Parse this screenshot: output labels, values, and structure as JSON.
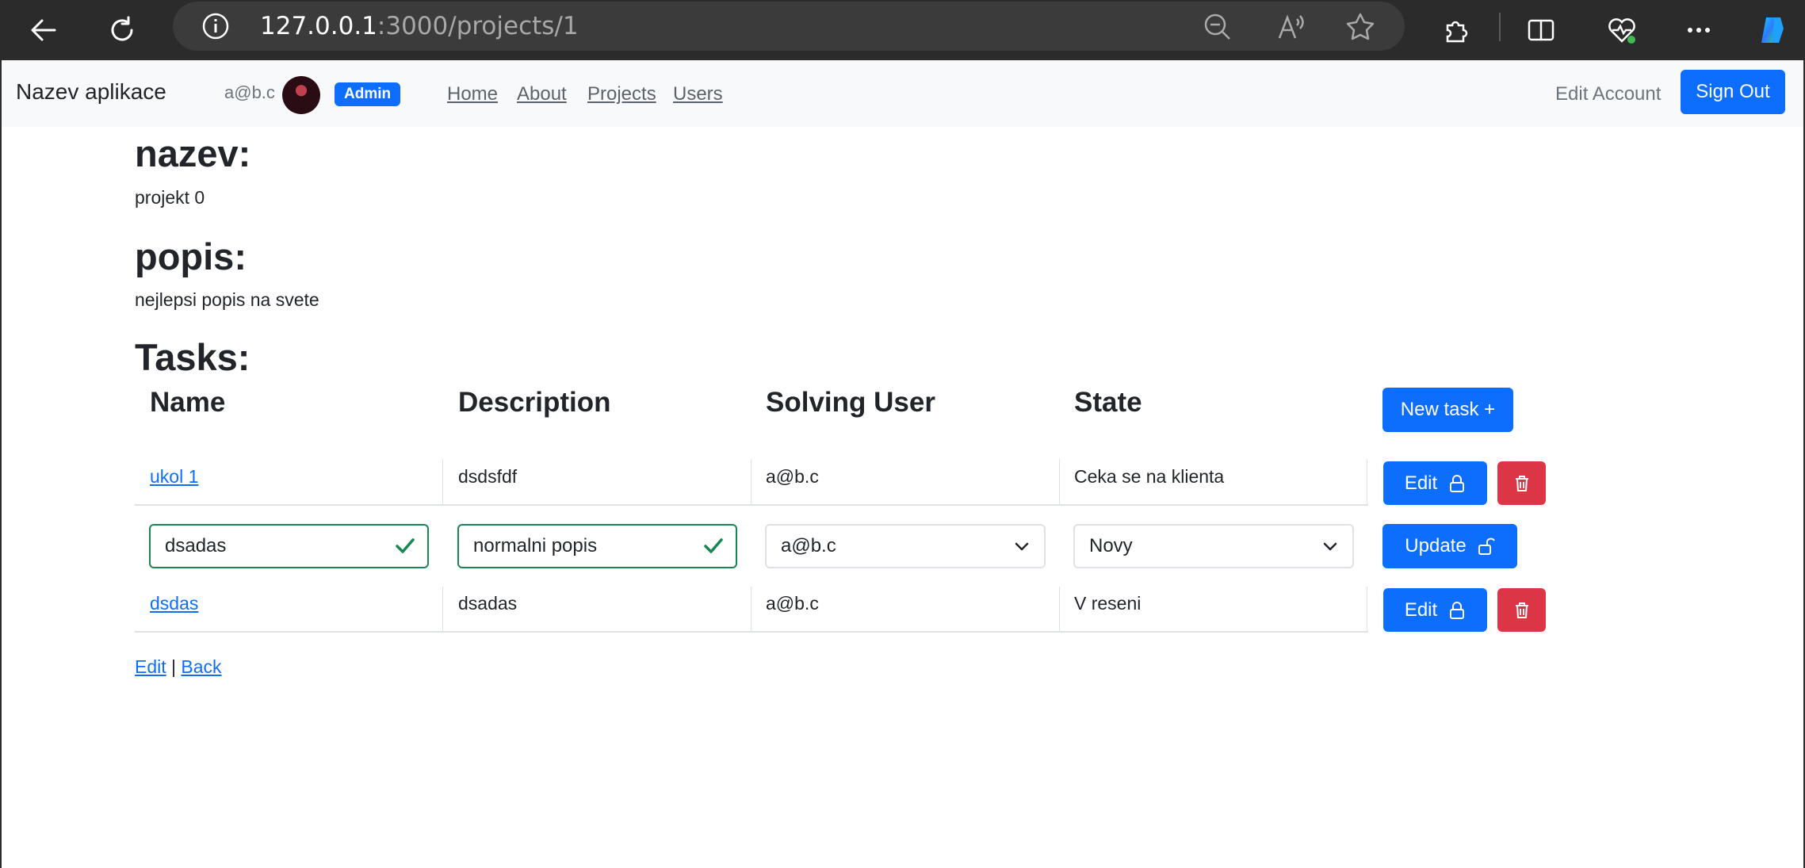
{
  "browser": {
    "url_host": "127.0.0.1",
    "url_path": ":3000/projects/1",
    "icons": [
      "back-arrow-icon",
      "refresh-icon",
      "info-icon",
      "zoom-out-icon",
      "read-aloud-icon",
      "favorite-star-icon",
      "extensions-icon",
      "split-screen-icon",
      "browser-essentials-icon",
      "more-icon",
      "copilot-icon"
    ]
  },
  "navbar": {
    "brand": "Nazev aplikace",
    "user_email": "a@b.c",
    "role_badge": "Admin",
    "links": [
      "Home",
      "About",
      "Projects",
      "Users"
    ],
    "edit_account": "Edit Account",
    "sign_out": "Sign Out"
  },
  "project": {
    "name_heading": "nazev:",
    "name_value": "projekt 0",
    "desc_heading": "popis:",
    "desc_value": "nejlepsi popis na svete",
    "tasks_heading": "Tasks:"
  },
  "table": {
    "headers": [
      "Name",
      "Description",
      "Solving User",
      "State"
    ],
    "new_task": "New task +",
    "rows": [
      {
        "name": "ukol 1",
        "description": "dsdsfdf",
        "user": "a@b.c",
        "state": "Ceka se na klienta",
        "action": "Edit"
      },
      {
        "name": "dsadas",
        "description": "normalni popis",
        "user": "a@b.c",
        "state": "Novy",
        "action": "Update"
      },
      {
        "name": "dsdas",
        "description": "dsadas",
        "user": "a@b.c",
        "state": "V reseni",
        "action": "Edit"
      }
    ]
  },
  "footer": {
    "edit": "Edit",
    "separator": "|",
    "back": "Back"
  },
  "colors": {
    "primary": "#0d6efd",
    "danger": "#dc3545",
    "success": "#198754"
  }
}
